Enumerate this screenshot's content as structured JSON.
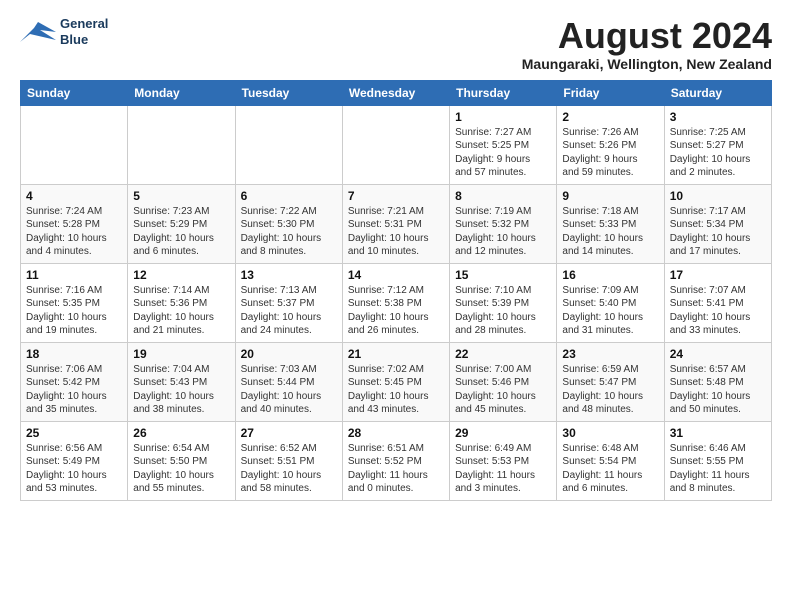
{
  "header": {
    "logo_line1": "General",
    "logo_line2": "Blue",
    "month_year": "August 2024",
    "location": "Maungaraki, Wellington, New Zealand"
  },
  "days_of_week": [
    "Sunday",
    "Monday",
    "Tuesday",
    "Wednesday",
    "Thursday",
    "Friday",
    "Saturday"
  ],
  "weeks": [
    [
      {
        "day": "",
        "info": ""
      },
      {
        "day": "",
        "info": ""
      },
      {
        "day": "",
        "info": ""
      },
      {
        "day": "",
        "info": ""
      },
      {
        "day": "1",
        "info": "Sunrise: 7:27 AM\nSunset: 5:25 PM\nDaylight: 9 hours\nand 57 minutes."
      },
      {
        "day": "2",
        "info": "Sunrise: 7:26 AM\nSunset: 5:26 PM\nDaylight: 9 hours\nand 59 minutes."
      },
      {
        "day": "3",
        "info": "Sunrise: 7:25 AM\nSunset: 5:27 PM\nDaylight: 10 hours\nand 2 minutes."
      }
    ],
    [
      {
        "day": "4",
        "info": "Sunrise: 7:24 AM\nSunset: 5:28 PM\nDaylight: 10 hours\nand 4 minutes."
      },
      {
        "day": "5",
        "info": "Sunrise: 7:23 AM\nSunset: 5:29 PM\nDaylight: 10 hours\nand 6 minutes."
      },
      {
        "day": "6",
        "info": "Sunrise: 7:22 AM\nSunset: 5:30 PM\nDaylight: 10 hours\nand 8 minutes."
      },
      {
        "day": "7",
        "info": "Sunrise: 7:21 AM\nSunset: 5:31 PM\nDaylight: 10 hours\nand 10 minutes."
      },
      {
        "day": "8",
        "info": "Sunrise: 7:19 AM\nSunset: 5:32 PM\nDaylight: 10 hours\nand 12 minutes."
      },
      {
        "day": "9",
        "info": "Sunrise: 7:18 AM\nSunset: 5:33 PM\nDaylight: 10 hours\nand 14 minutes."
      },
      {
        "day": "10",
        "info": "Sunrise: 7:17 AM\nSunset: 5:34 PM\nDaylight: 10 hours\nand 17 minutes."
      }
    ],
    [
      {
        "day": "11",
        "info": "Sunrise: 7:16 AM\nSunset: 5:35 PM\nDaylight: 10 hours\nand 19 minutes."
      },
      {
        "day": "12",
        "info": "Sunrise: 7:14 AM\nSunset: 5:36 PM\nDaylight: 10 hours\nand 21 minutes."
      },
      {
        "day": "13",
        "info": "Sunrise: 7:13 AM\nSunset: 5:37 PM\nDaylight: 10 hours\nand 24 minutes."
      },
      {
        "day": "14",
        "info": "Sunrise: 7:12 AM\nSunset: 5:38 PM\nDaylight: 10 hours\nand 26 minutes."
      },
      {
        "day": "15",
        "info": "Sunrise: 7:10 AM\nSunset: 5:39 PM\nDaylight: 10 hours\nand 28 minutes."
      },
      {
        "day": "16",
        "info": "Sunrise: 7:09 AM\nSunset: 5:40 PM\nDaylight: 10 hours\nand 31 minutes."
      },
      {
        "day": "17",
        "info": "Sunrise: 7:07 AM\nSunset: 5:41 PM\nDaylight: 10 hours\nand 33 minutes."
      }
    ],
    [
      {
        "day": "18",
        "info": "Sunrise: 7:06 AM\nSunset: 5:42 PM\nDaylight: 10 hours\nand 35 minutes."
      },
      {
        "day": "19",
        "info": "Sunrise: 7:04 AM\nSunset: 5:43 PM\nDaylight: 10 hours\nand 38 minutes."
      },
      {
        "day": "20",
        "info": "Sunrise: 7:03 AM\nSunset: 5:44 PM\nDaylight: 10 hours\nand 40 minutes."
      },
      {
        "day": "21",
        "info": "Sunrise: 7:02 AM\nSunset: 5:45 PM\nDaylight: 10 hours\nand 43 minutes."
      },
      {
        "day": "22",
        "info": "Sunrise: 7:00 AM\nSunset: 5:46 PM\nDaylight: 10 hours\nand 45 minutes."
      },
      {
        "day": "23",
        "info": "Sunrise: 6:59 AM\nSunset: 5:47 PM\nDaylight: 10 hours\nand 48 minutes."
      },
      {
        "day": "24",
        "info": "Sunrise: 6:57 AM\nSunset: 5:48 PM\nDaylight: 10 hours\nand 50 minutes."
      }
    ],
    [
      {
        "day": "25",
        "info": "Sunrise: 6:56 AM\nSunset: 5:49 PM\nDaylight: 10 hours\nand 53 minutes."
      },
      {
        "day": "26",
        "info": "Sunrise: 6:54 AM\nSunset: 5:50 PM\nDaylight: 10 hours\nand 55 minutes."
      },
      {
        "day": "27",
        "info": "Sunrise: 6:52 AM\nSunset: 5:51 PM\nDaylight: 10 hours\nand 58 minutes."
      },
      {
        "day": "28",
        "info": "Sunrise: 6:51 AM\nSunset: 5:52 PM\nDaylight: 11 hours\nand 0 minutes."
      },
      {
        "day": "29",
        "info": "Sunrise: 6:49 AM\nSunset: 5:53 PM\nDaylight: 11 hours\nand 3 minutes."
      },
      {
        "day": "30",
        "info": "Sunrise: 6:48 AM\nSunset: 5:54 PM\nDaylight: 11 hours\nand 6 minutes."
      },
      {
        "day": "31",
        "info": "Sunrise: 6:46 AM\nSunset: 5:55 PM\nDaylight: 11 hours\nand 8 minutes."
      }
    ]
  ]
}
